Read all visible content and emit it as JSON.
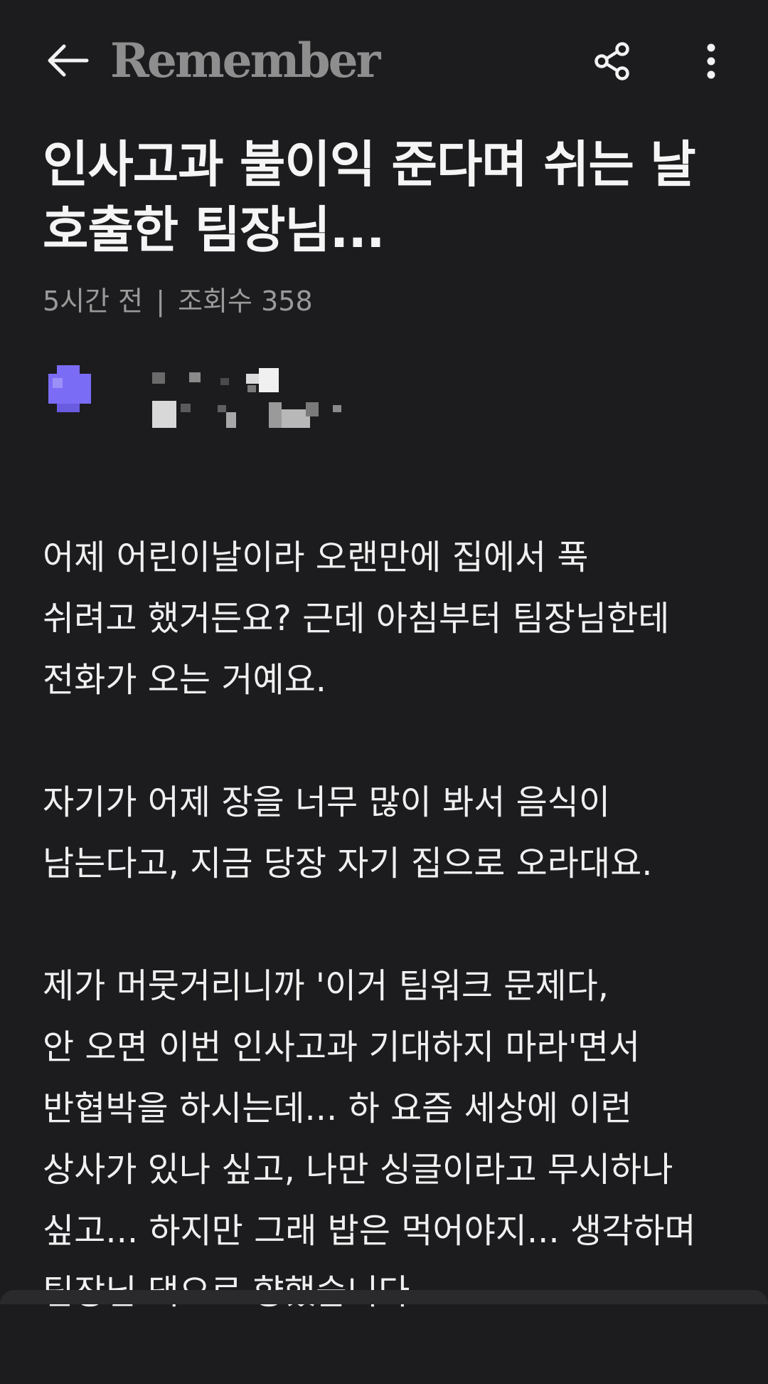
{
  "header": {
    "logo_text": "Remember",
    "back_icon": "arrow-left-icon",
    "share_icon": "share-icon",
    "more_icon": "more-vertical-icon"
  },
  "post": {
    "title": "인사고과 불이익 준다며 쉬는 날 호출한 팀장님...",
    "time_ago": "5시간 전",
    "separator": "|",
    "views": "조회수 358",
    "author": {
      "avatar_color": "#7b6cf6"
    },
    "paragraphs": [
      "어제 어린이날이라 오랜만에 집에서 푹\n쉬려고 했거든요? 근데 아침부터 팀장님한테\n전화가 오는 거예요.",
      "자기가 어제 장을 너무 많이 봐서 음식이\n남는다고, 지금 당장 자기 집으로 오라대요.",
      "제가 머뭇거리니까 '이거 팀워크 문제다,\n안 오면 이번 인사고과 기대하지 마라'면서\n반협박을 하시는데... 하 요즘 세상에 이런\n상사가 있나 싶고, 나만 싱글이라고 무시하나\n싶고... 하지만 그래 밥은 먹어야지... 생각하며\n팀장님 댁으로 향했습니다."
    ]
  },
  "colors": {
    "background": "#1c1c1e",
    "text": "#f0f0f0",
    "meta": "#9a9a9a",
    "logo": "#8e8e8e"
  }
}
